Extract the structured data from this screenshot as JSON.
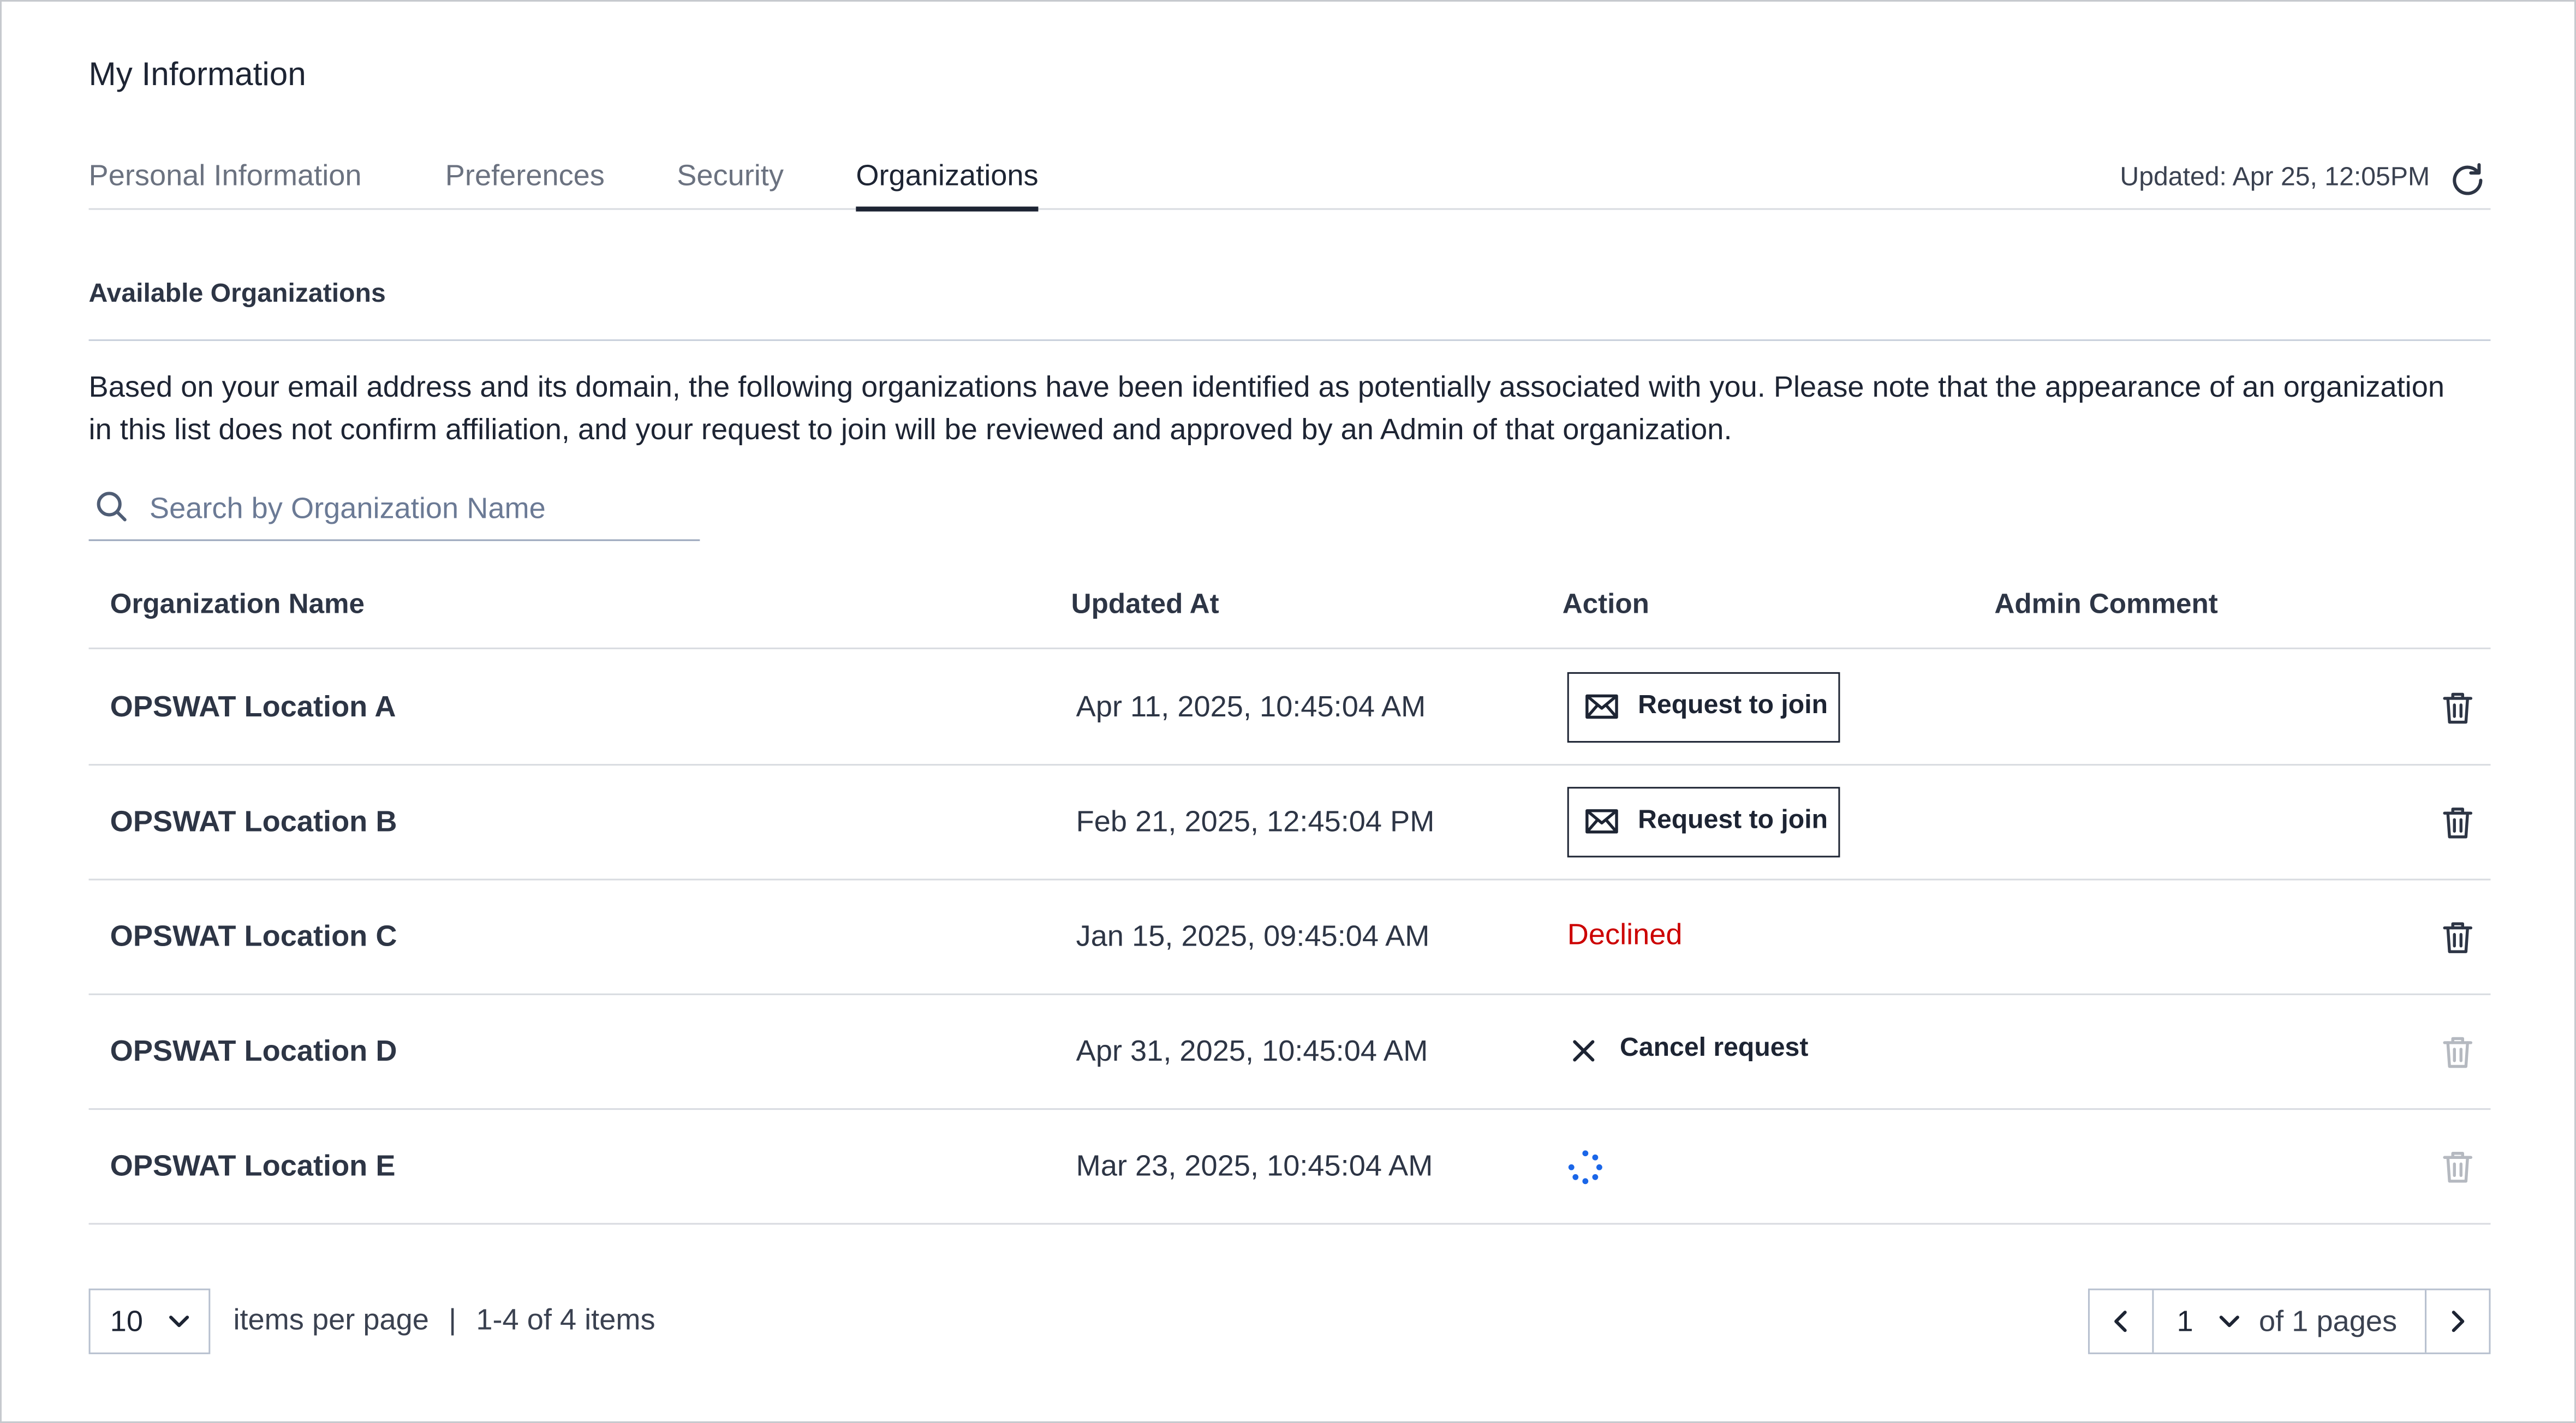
{
  "page": {
    "title": "My Information"
  },
  "tabs": [
    {
      "label": "Personal Information",
      "active": false
    },
    {
      "label": "Preferences",
      "active": false
    },
    {
      "label": "Security",
      "active": false
    },
    {
      "label": "Organizations",
      "active": true
    }
  ],
  "header": {
    "updated_text": "Updated: Apr 25, 12:05PM",
    "refresh_icon": "refresh-icon"
  },
  "section": {
    "title": "Available Organizations",
    "description": "Based on your email address and its domain, the following organizations have been identified as potentially associated with you. Please note that the appearance of an organization in this list does not confirm affiliation, and your request to join will be reviewed and approved by an Admin of that organization."
  },
  "search": {
    "placeholder": "Search by Organization Name",
    "value": "",
    "icon": "search-icon"
  },
  "table": {
    "columns": [
      "Organization Name",
      "Updated At",
      "Action",
      "Admin Comment"
    ],
    "rows": [
      {
        "name": "OPSWAT Location A",
        "updated_at": "Apr 11, 2025, 10:45:04 AM",
        "action": {
          "type": "button",
          "label": "Request to join",
          "icon": "mail-icon"
        },
        "admin_comment": "",
        "delete_enabled": true
      },
      {
        "name": "OPSWAT Location B",
        "updated_at": "Feb 21, 2025, 12:45:04 PM",
        "action": {
          "type": "button",
          "label": "Request to join",
          "icon": "mail-icon"
        },
        "admin_comment": "",
        "delete_enabled": true
      },
      {
        "name": "OPSWAT Location C",
        "updated_at": "Jan 15, 2025, 09:45:04 AM",
        "action": {
          "type": "status",
          "label": "Declined",
          "color": "#cc0000"
        },
        "admin_comment": "",
        "delete_enabled": true
      },
      {
        "name": "OPSWAT Location D",
        "updated_at": "Apr 31, 2025, 10:45:04 AM",
        "action": {
          "type": "link",
          "label": "Cancel request",
          "icon": "close-icon"
        },
        "admin_comment": "",
        "delete_enabled": false
      },
      {
        "name": "OPSWAT Location E",
        "updated_at": "Mar 23, 2025, 10:45:04 AM",
        "action": {
          "type": "loading",
          "icon": "spinner-icon",
          "color": "#1a66e8"
        },
        "admin_comment": "",
        "delete_enabled": false
      }
    ]
  },
  "pagination": {
    "page_size": "10",
    "per_page_label": "items per page",
    "separator": "|",
    "range_label": "1-4 of 4 items",
    "current_page": "1",
    "of_pages_label": "of 1 pages"
  },
  "colors": {
    "text": "#1d2433",
    "declined": "#cc0000",
    "spinner": "#1a66e8",
    "disabled_icon": "#b5b9c0"
  }
}
